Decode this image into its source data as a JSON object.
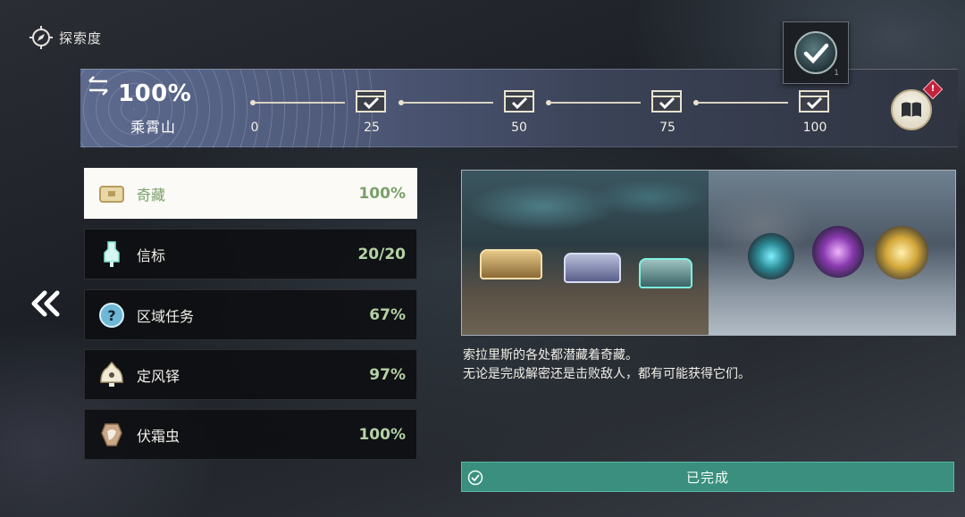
{
  "header": {
    "title": "探索度",
    "icon": "compass-icon"
  },
  "banner": {
    "percent": "100%",
    "region": "乘霄山",
    "ticks": [
      "0",
      "25",
      "50",
      "75",
      "100"
    ],
    "progress": 1.0,
    "alert_badge": "!"
  },
  "reward_popup": {
    "count": "1"
  },
  "categories": [
    {
      "name": "奇藏",
      "value": "100%",
      "icon": "chest-icon",
      "selected": true
    },
    {
      "name": "信标",
      "value": "20/20",
      "icon": "beacon-icon",
      "selected": false
    },
    {
      "name": "区域任务",
      "value": "67%",
      "icon": "question-icon",
      "selected": false
    },
    {
      "name": "定风铎",
      "value": "97%",
      "icon": "bell-icon",
      "selected": false
    },
    {
      "name": "伏霜虫",
      "value": "100%",
      "icon": "bug-icon",
      "selected": false
    }
  ],
  "description": {
    "line1": "索拉里斯的各处都潜藏着奇藏。",
    "line2": "无论是完成解密还是击败敌人，都有可能获得它们。"
  },
  "status": {
    "label": "已完成"
  },
  "colors": {
    "accent_green": "#7aa06a",
    "complete_bar": "#3a8f7e",
    "alert_red": "#c0243c"
  }
}
